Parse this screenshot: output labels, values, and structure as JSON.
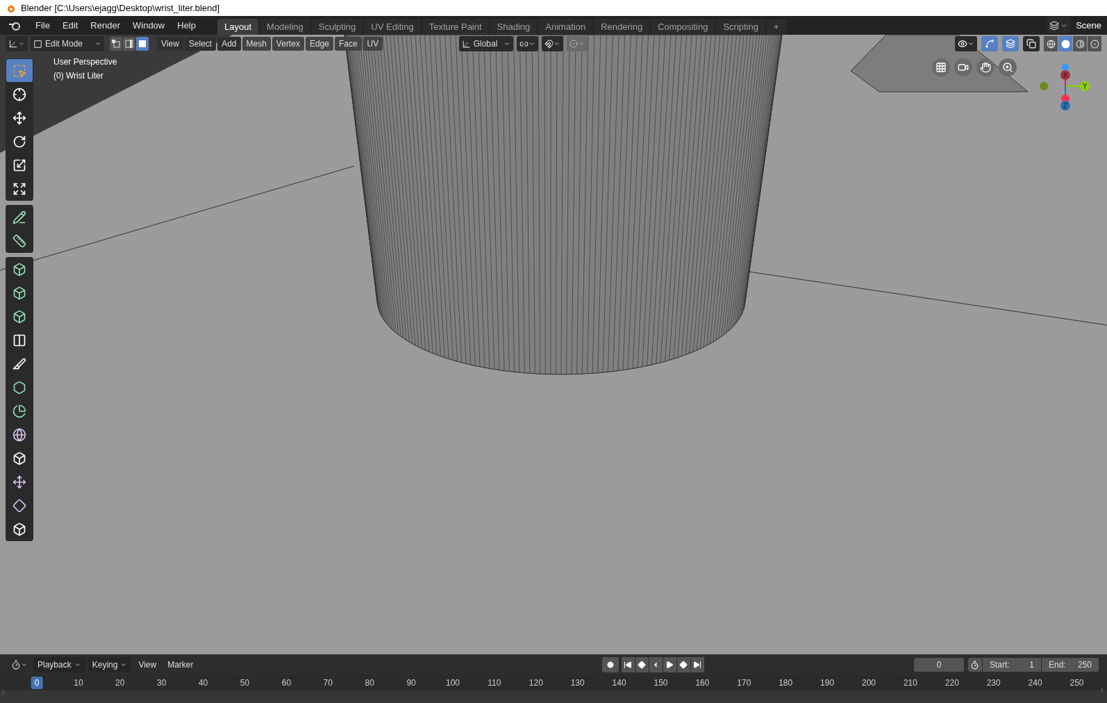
{
  "window": {
    "title": "Blender [C:\\Users\\ejagg\\Desktop\\wrist_liter.blend]"
  },
  "menu": [
    "File",
    "Edit",
    "Render",
    "Window",
    "Help"
  ],
  "workspace_tabs": [
    {
      "label": "Layout",
      "selected": true
    },
    {
      "label": "Modeling",
      "selected": false
    },
    {
      "label": "Sculpting",
      "selected": false
    },
    {
      "label": "UV Editing",
      "selected": false
    },
    {
      "label": "Texture Paint",
      "selected": false
    },
    {
      "label": "Shading",
      "selected": false
    },
    {
      "label": "Animation",
      "selected": false
    },
    {
      "label": "Rendering",
      "selected": false
    },
    {
      "label": "Compositing",
      "selected": false
    },
    {
      "label": "Scripting",
      "selected": false
    },
    {
      "label": "+",
      "selected": false
    }
  ],
  "scene": {
    "label": "Scene"
  },
  "viewport": {
    "mode": "Edit Mode",
    "select_modes": [
      {
        "kind": "vertex",
        "selected": false
      },
      {
        "kind": "edge",
        "selected": false
      },
      {
        "kind": "face",
        "selected": true
      }
    ],
    "menus": [
      "View",
      "Select",
      "Add",
      "Mesh",
      "Vertex",
      "Edge",
      "Face",
      "UV"
    ],
    "orientation": "Global",
    "toggles": [
      {
        "kind": "gizmos",
        "on": true
      },
      {
        "kind": "overlays",
        "on": true
      },
      {
        "kind": "xray",
        "on": false
      }
    ],
    "shading": [
      {
        "kind": "wireframe",
        "selected": false
      },
      {
        "kind": "solid",
        "selected": true
      },
      {
        "kind": "material",
        "selected": false
      },
      {
        "kind": "rendered",
        "selected": false
      }
    ],
    "info": [
      "User Perspective",
      "(0) Wrist Liter"
    ],
    "axes": [
      "X",
      "Y",
      "Z"
    ],
    "tool_groups": [
      [
        {
          "kind": "select",
          "selected": true
        },
        {
          "kind": "cursor",
          "selected": false
        },
        {
          "kind": "move",
          "selected": false
        },
        {
          "kind": "rotate",
          "selected": false
        },
        {
          "kind": "scale",
          "selected": false
        },
        {
          "kind": "transform",
          "selected": false
        }
      ],
      [
        {
          "kind": "annotate",
          "selected": false
        },
        {
          "kind": "measure",
          "selected": false
        }
      ],
      [
        {
          "kind": "extrude",
          "selected": false
        },
        {
          "kind": "inset",
          "selected": false
        },
        {
          "kind": "bevel",
          "selected": false
        },
        {
          "kind": "loopcut",
          "selected": false
        },
        {
          "kind": "knife",
          "selected": false
        },
        {
          "kind": "polybuild",
          "selected": false
        },
        {
          "kind": "spin",
          "selected": false
        },
        {
          "kind": "smooth",
          "selected": false
        },
        {
          "kind": "edgeslide",
          "selected": false
        },
        {
          "kind": "shrink",
          "selected": false
        },
        {
          "kind": "shear",
          "selected": false
        },
        {
          "kind": "rip",
          "selected": false
        }
      ]
    ]
  },
  "timeline": {
    "menus": [
      {
        "label": "Playback",
        "kind": "dropdown"
      },
      {
        "label": "Keying",
        "kind": "dropdown"
      },
      {
        "label": "View",
        "kind": "menu"
      },
      {
        "label": "Marker",
        "kind": "menu"
      }
    ],
    "current_frame": "0",
    "start_label": "Start:",
    "start": "1",
    "end_label": "End:",
    "end": "250",
    "ruler": [
      {
        "label": "0",
        "selected": true
      },
      {
        "label": "10",
        "selected": false
      },
      {
        "label": "20",
        "selected": false
      },
      {
        "label": "30",
        "selected": false
      },
      {
        "label": "40",
        "selected": false
      },
      {
        "label": "50",
        "selected": false
      },
      {
        "label": "60",
        "selected": false
      },
      {
        "label": "70",
        "selected": false
      },
      {
        "label": "80",
        "selected": false
      },
      {
        "label": "90",
        "selected": false
      },
      {
        "label": "100",
        "selected": false
      },
      {
        "label": "110",
        "selected": false
      },
      {
        "label": "120",
        "selected": false
      },
      {
        "label": "130",
        "selected": false
      },
      {
        "label": "140",
        "selected": false
      },
      {
        "label": "150",
        "selected": false
      },
      {
        "label": "160",
        "selected": false
      },
      {
        "label": "170",
        "selected": false
      },
      {
        "label": "180",
        "selected": false
      },
      {
        "label": "190",
        "selected": false
      },
      {
        "label": "200",
        "selected": false
      },
      {
        "label": "210",
        "selected": false
      },
      {
        "label": "220",
        "selected": false
      },
      {
        "label": "230",
        "selected": false
      },
      {
        "label": "240",
        "selected": false
      },
      {
        "label": "250",
        "selected": false
      }
    ]
  }
}
